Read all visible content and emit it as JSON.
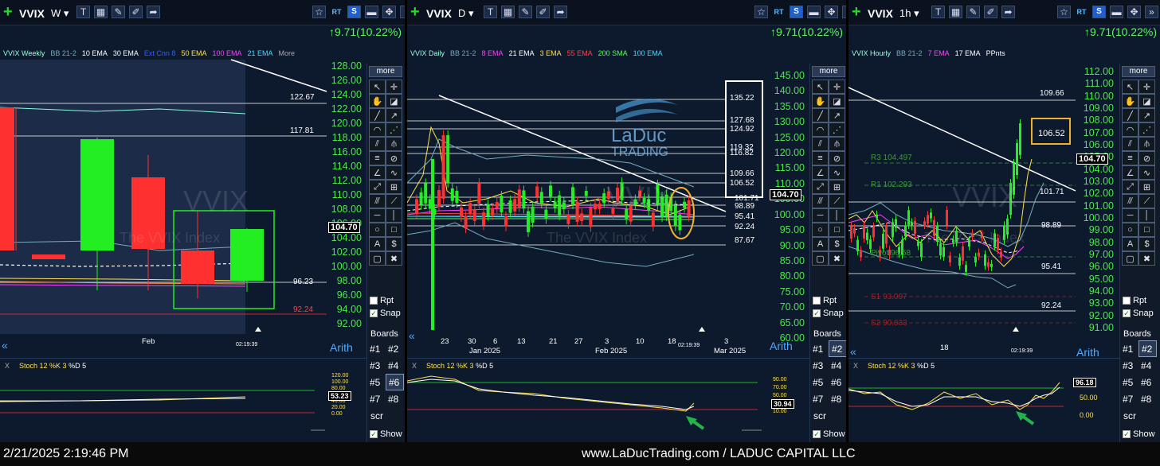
{
  "panels": [
    {
      "symbol": "VVIX",
      "period": "W",
      "change": "↑9.71(10.22%)",
      "legend": [
        {
          "text": "VVIX Weekly",
          "color": "#9fd"
        },
        {
          "text": "BB 21-2",
          "color": "#7ab"
        },
        {
          "text": "10 EMA",
          "color": "#fff"
        },
        {
          "text": "30 EMA",
          "color": "#fff"
        },
        {
          "text": "Ext Cnn 8",
          "color": "#3060ff"
        },
        {
          "text": "50 EMA",
          "color": "#ffe04a"
        },
        {
          "text": "100 EMA",
          "color": "#ff40ff"
        },
        {
          "text": "21 EMA",
          "color": "#4ad8ff"
        },
        {
          "text": "More",
          "color": "#aaa"
        }
      ],
      "y_ticks": [
        "128.00",
        "126.00",
        "124.00",
        "122.00",
        "120.00",
        "118.00",
        "116.00",
        "114.00",
        "112.00",
        "110.00",
        "108.00",
        "106.00",
        "104.00",
        "102.00",
        "100.00",
        "98.00",
        "96.00",
        "94.00",
        "92.00"
      ],
      "price_flag": "104.70",
      "level_labels": [
        "122.67",
        "117.81",
        "96.23",
        "92.24"
      ],
      "x_labels": [
        "Feb"
      ],
      "timestamp": "02:19:39",
      "scale": "Arith",
      "watermark": "VVIX",
      "watermark_sub": "The VVIX Index",
      "indicator": {
        "label": "Stoch 12 %K 3",
        "d_label": "%D 5",
        "ticks": [
          "120.00",
          "100.00",
          "80.00",
          "60.00",
          "40.00",
          "20.00",
          "0.00"
        ],
        "flag": "53.23"
      }
    },
    {
      "symbol": "VVIX",
      "period": "D",
      "change": "↑9.71(10.22%)",
      "legend": [
        {
          "text": "VVIX Daily",
          "color": "#9fd"
        },
        {
          "text": "BB 21-2",
          "color": "#7ab"
        },
        {
          "text": "8 EMA",
          "color": "#ff40ff"
        },
        {
          "text": "21 EMA",
          "color": "#fff"
        },
        {
          "text": "3 EMA",
          "color": "#ffe04a"
        },
        {
          "text": "55 EMA",
          "color": "#ff4040"
        },
        {
          "text": "200 SMA",
          "color": "#5f5"
        },
        {
          "text": "100 EMA",
          "color": "#4ad8ff"
        }
      ],
      "y_ticks": [
        "145.00",
        "140.00",
        "135.00",
        "130.00",
        "125.00",
        "120.00",
        "115.00",
        "110.00",
        "105.00",
        "100.00",
        "95.00",
        "90.00",
        "85.00",
        "80.00",
        "75.00",
        "70.00",
        "65.00",
        "60.00"
      ],
      "price_flag": "104.70",
      "level_labels": [
        "135.22",
        "127.68",
        "124.92",
        "119.32",
        "116.82",
        "109.66",
        "106.52",
        "101.71",
        "98.89",
        "95.41",
        "92.24",
        "87.67"
      ],
      "x_labels": [
        "23",
        "30",
        "6",
        "13",
        "21",
        "27",
        "3",
        "10",
        "18",
        "3"
      ],
      "x_month_labels": [
        "Jan 2025",
        "Feb 2025",
        "Mar 2025"
      ],
      "timestamp": "02:19:39",
      "scale": "Arith",
      "watermark": "VVIX",
      "watermark_sub": "The VVIX Index",
      "logo": {
        "line1": "LaDuc",
        "line2": "TRADING"
      },
      "indicator": {
        "label": "Stoch 12 %K 3",
        "d_label": "%D 5",
        "ticks": [
          "90.00",
          "70.00",
          "50.00",
          "30.00",
          "10.00"
        ],
        "flag": "30.94"
      }
    },
    {
      "symbol": "VVIX",
      "period": "1h",
      "change": "↑9.71(10.22%)",
      "legend": [
        {
          "text": "VVIX Hourly",
          "color": "#9fd"
        },
        {
          "text": "BB 21-2",
          "color": "#7ab"
        },
        {
          "text": "7 EMA",
          "color": "#ff40ff"
        },
        {
          "text": "17 EMA",
          "color": "#fff"
        },
        {
          "text": "PPnts",
          "color": "#fff"
        }
      ],
      "y_ticks": [
        "112.00",
        "111.00",
        "110.00",
        "109.00",
        "108.00",
        "107.00",
        "106.00",
        "105.00",
        "104.00",
        "103.00",
        "102.00",
        "101.00",
        "100.00",
        "99.00",
        "98.00",
        "97.00",
        "96.00",
        "95.00",
        "94.00",
        "93.00",
        "92.00",
        "91.00"
      ],
      "price_flag": "104.70",
      "level_labels": [
        "109.66",
        "106.52",
        "101.71",
        "98.89",
        "95.41",
        "92.24"
      ],
      "pivot_labels": [
        "R3 104.497",
        "R1 102.293",
        "Pivot 96.58",
        "S1 93.097",
        "S2 90.833"
      ],
      "x_labels": [
        "18"
      ],
      "timestamp": "02:19:39",
      "scale": "Arith",
      "watermark": "VVIX",
      "watermark_sub": "The VVIX Index",
      "indicator": {
        "label": "Stoch 12 %K 3",
        "d_label": "%D 5",
        "ticks": [
          "50.00",
          "0.00"
        ],
        "flag": "96.18"
      }
    }
  ],
  "toolbar": {
    "more": "more",
    "rpt": "Rpt",
    "snap": "Snap",
    "boards": "Boards",
    "board_items": [
      "#1",
      "#2",
      "#3",
      "#4",
      "#5",
      "#6",
      "#7",
      "#8"
    ],
    "scr": "scr",
    "show": "Show"
  },
  "footer": {
    "datetime": "2/21/2025 2:19:46 PM",
    "site": "www.LaDucTrading.com / LADUC CAPITAL LLC"
  },
  "colors": {
    "up": "#22ee22",
    "down": "#ff3030",
    "axis": "#4ee44e",
    "highlight": "#f0b030"
  }
}
